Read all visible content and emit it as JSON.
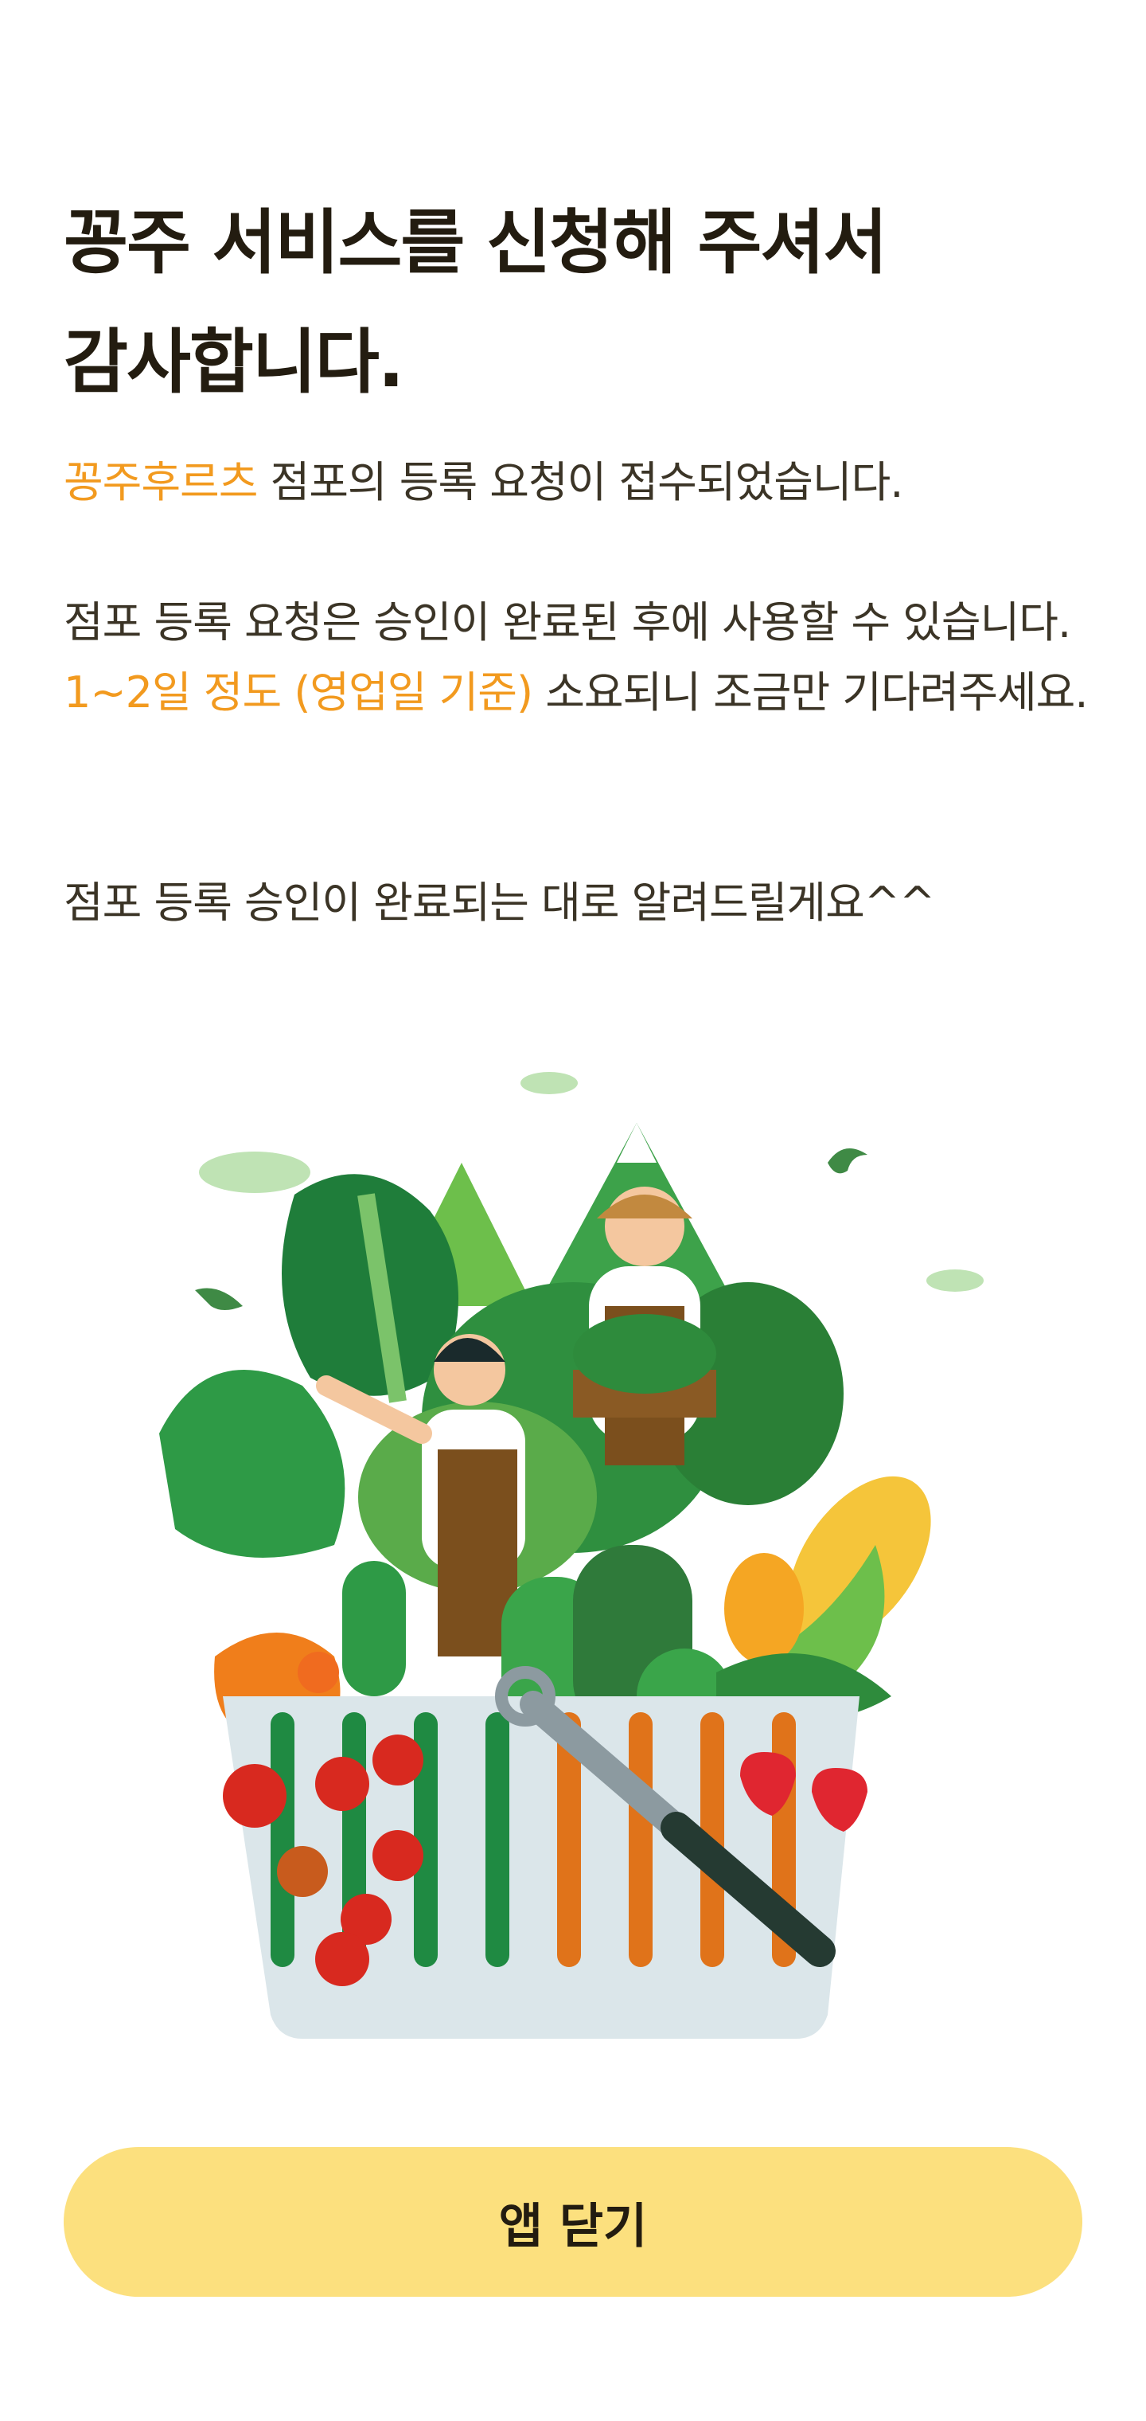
{
  "title": {
    "line1": "꽁주 서비스를 신청해 주셔서",
    "line2": "감사합니다."
  },
  "message": {
    "store_name": "꽁주후르츠",
    "registration_received": " 점포의 등록 요청이 접수되었습니다.",
    "approval_info_prefix": "점포 등록 요청은 승인이 완료된 후에 사용할 수 있습니다. ",
    "approval_duration": "1~2일 정도 (영업일 기준)",
    "approval_info_suffix": " 소요되니 조금만 기다려주세요.",
    "notify_text": "점포 등록 승인이 완료되는 대로 알려드릴게요^^"
  },
  "illustration": {
    "icon": "vegetable-basket-illustration"
  },
  "actions": {
    "close_label": "앱 닫기"
  },
  "colors": {
    "highlight": "#f29a1f",
    "button_bg": "#fce07e",
    "text_primary": "#231c10",
    "text_body": "#3b3426"
  }
}
